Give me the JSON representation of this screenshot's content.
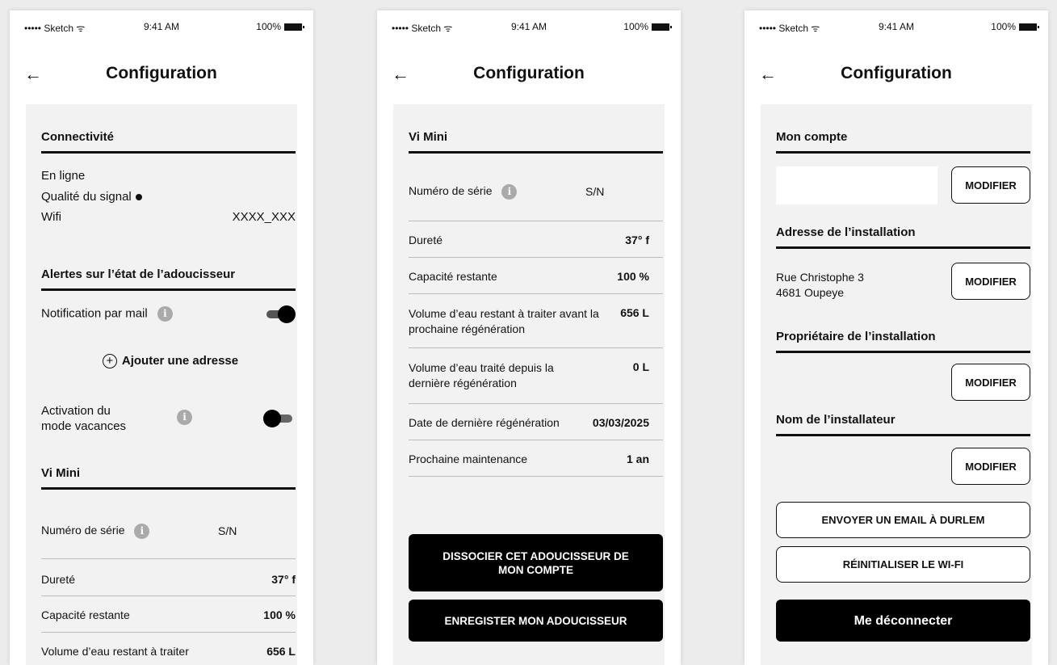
{
  "status_bar": {
    "carrier": "••••• Sketch",
    "time": "9:41 AM",
    "battery": "100%"
  },
  "header": {
    "back_icon": "←",
    "title": "Configuration"
  },
  "screen1": {
    "connectivity": {
      "section_title": "Connectivité",
      "online": "En ligne",
      "signal_label": "Qualité du signal",
      "wifi_label": "Wifi",
      "wifi_value": "XXXX_XXX"
    },
    "alerts": {
      "section_title": "Alertes sur l’état de l’adoucisseur",
      "mail_notification": "Notification par mail",
      "mail_toggle": true,
      "add_address": "Ajouter une adresse",
      "vacation_line1": "Activation du",
      "vacation_line2": "mode vacances",
      "vacation_toggle": false
    },
    "device": {
      "section_title": "Vi Mini",
      "serial_label": "Numéro de série",
      "serial_value": "S/N",
      "hardness_label": "Dureté",
      "hardness_value": "37° f",
      "capacity_label": "Capacité restante",
      "capacity_value": "100 %",
      "volume_label": "Volume d’eau restant à traiter",
      "volume_value": "656 L"
    }
  },
  "screen2": {
    "section_title": "Vi Mini",
    "serial_label": "Numéro de série",
    "serial_value": "S/N",
    "rows": [
      {
        "label": "Dureté",
        "value": "37° f"
      },
      {
        "label": "Capacité restante",
        "value": "100 %"
      },
      {
        "label": "Volume d’eau restant à traiter avant la prochaine régénération",
        "value": "656 L"
      },
      {
        "label": "Volume d’eau traité depuis la dernière régénération",
        "value": "0 L"
      },
      {
        "label": "Date de dernière régénération",
        "value": "03/03/2025"
      },
      {
        "label": "Prochaine maintenance",
        "value": "1 an"
      }
    ],
    "dissociate_button": "DISSOCIER CET ADOUCISSEUR DE MON COMPTE",
    "register_button": "ENREGISTER MON ADOUCISSEUR"
  },
  "screen3": {
    "account_title": "Mon compte",
    "address_title": "Adresse de l’installation",
    "address_line1": "Rue Christophe 3",
    "address_line2": "4681 Oupeye",
    "owner_title": "Propriétaire de l’installation",
    "installer_title": "Nom de l’installateur",
    "modify_label": "MODIFIER",
    "email_button": "ENVOYER UN EMAIL À DURLEM",
    "reset_wifi_button": "RÉINITIALISER LE WI-FI",
    "logout_button": "Me déconnecter"
  }
}
